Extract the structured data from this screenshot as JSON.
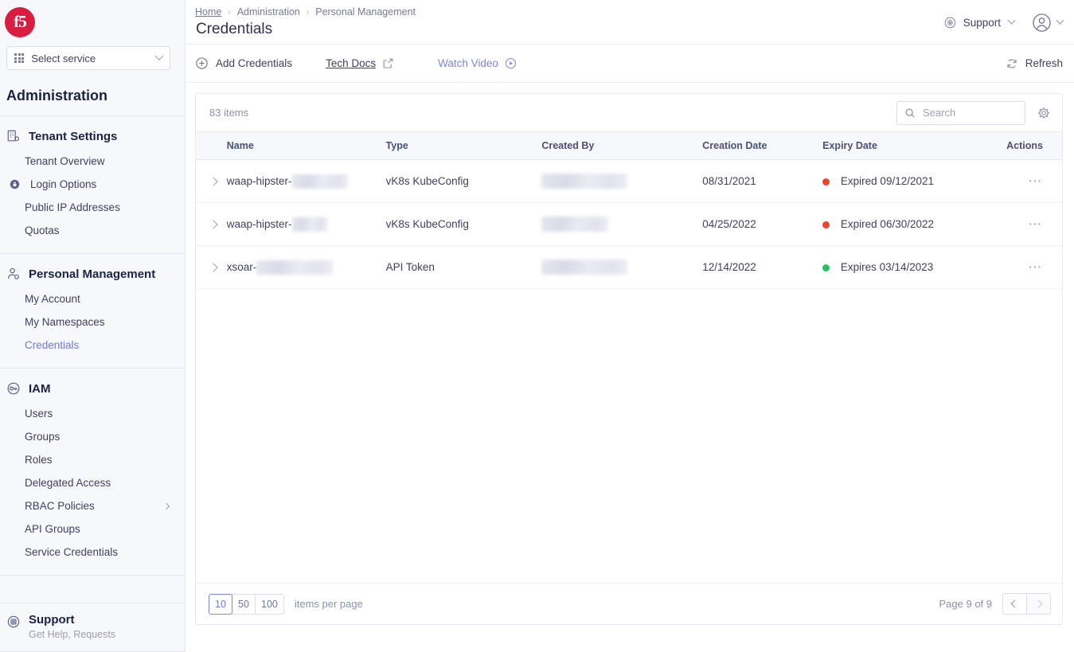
{
  "sidebar": {
    "logo": "f5",
    "service_select": {
      "label": "Select service"
    },
    "section_title": "Administration",
    "groups": [
      {
        "title": "Tenant Settings",
        "icon": "building-icon",
        "items": [
          {
            "label": "Tenant Overview",
            "icon": null,
            "active": false
          },
          {
            "label": "Login Options",
            "icon": "lock-icon",
            "active": false
          },
          {
            "label": "Public IP Addresses",
            "icon": null,
            "active": false
          },
          {
            "label": "Quotas",
            "icon": null,
            "active": false
          }
        ]
      },
      {
        "title": "Personal Management",
        "icon": "user-gear-icon",
        "items": [
          {
            "label": "My Account",
            "icon": null,
            "active": false
          },
          {
            "label": "My Namespaces",
            "icon": null,
            "active": false
          },
          {
            "label": "Credentials",
            "icon": null,
            "active": true
          }
        ]
      },
      {
        "title": "IAM",
        "icon": "key-icon",
        "items": [
          {
            "label": "Users",
            "icon": null,
            "active": false
          },
          {
            "label": "Groups",
            "icon": null,
            "active": false
          },
          {
            "label": "Roles",
            "icon": null,
            "active": false
          },
          {
            "label": "Delegated Access",
            "icon": null,
            "active": false
          },
          {
            "label": "RBAC Policies",
            "icon": null,
            "active": false,
            "submenu": true
          },
          {
            "label": "API Groups",
            "icon": null,
            "active": false
          },
          {
            "label": "Service Credentials",
            "icon": null,
            "active": false
          }
        ]
      }
    ],
    "support": {
      "title": "Support",
      "subtitle": "Get Help, Requests",
      "icon": "lifebuoy-icon"
    }
  },
  "header": {
    "breadcrumb": [
      "Home",
      "Administration",
      "Personal Management"
    ],
    "separator": "›",
    "title": "Credentials",
    "support_label": "Support",
    "support_icon": "lifebuoy-icon",
    "avatar_icon": "user-avatar-icon"
  },
  "toolbar": {
    "add_label": "Add Credentials",
    "add_icon": "plus-circle-icon",
    "tech_docs_label": "Tech Docs",
    "tech_docs_icon": "external-link-icon",
    "watch_video_label": "Watch Video",
    "watch_video_icon": "play-circle-icon",
    "refresh_label": "Refresh",
    "refresh_icon": "refresh-icon"
  },
  "table": {
    "item_count": "83 items",
    "search": {
      "placeholder": "Search",
      "value": "",
      "icon": "search-icon"
    },
    "settings_icon": "gear-icon",
    "columns": [
      "Name",
      "Type",
      "Created By",
      "Creation Date",
      "Expiry Date",
      "Actions"
    ],
    "rows": [
      {
        "name_prefix": "waap-hipster-",
        "name_redacted_width": 70,
        "type": "vK8s KubeConfig",
        "created_by_redacted_width": 108,
        "creation_date": "08/31/2021",
        "expiry_status": "expired",
        "expiry_dot_color": "#f1432b",
        "expiry_label": "Expired 09/12/2021",
        "actions_icon": "ellipsis-icon"
      },
      {
        "name_prefix": "waap-hipster-",
        "name_redacted_width": 44,
        "type": "vK8s KubeConfig",
        "created_by_redacted_width": 84,
        "creation_date": "04/25/2022",
        "expiry_status": "expired",
        "expiry_dot_color": "#f1432b",
        "expiry_label": "Expired 06/30/2022",
        "actions_icon": "ellipsis-icon"
      },
      {
        "name_prefix": "xsoar-",
        "name_redacted_width": 96,
        "type": "API Token",
        "created_by_redacted_width": 108,
        "creation_date": "12/14/2022",
        "expiry_status": "active",
        "expiry_dot_color": "#24c45e",
        "expiry_label": "Expires 03/14/2023",
        "actions_icon": "ellipsis-icon"
      }
    ]
  },
  "footer": {
    "per_page_options": [
      "10",
      "50",
      "100"
    ],
    "per_page_selected": "10",
    "per_page_label": "items per page",
    "page_text": "Page 9 of 9",
    "prev_icon": "chevron-left-icon",
    "next_icon": "chevron-right-icon"
  },
  "colors": {
    "brand_red": "#d81d41",
    "accent_blue": "#6d79e8",
    "expired_red": "#f1432b",
    "active_green": "#24c45e"
  }
}
